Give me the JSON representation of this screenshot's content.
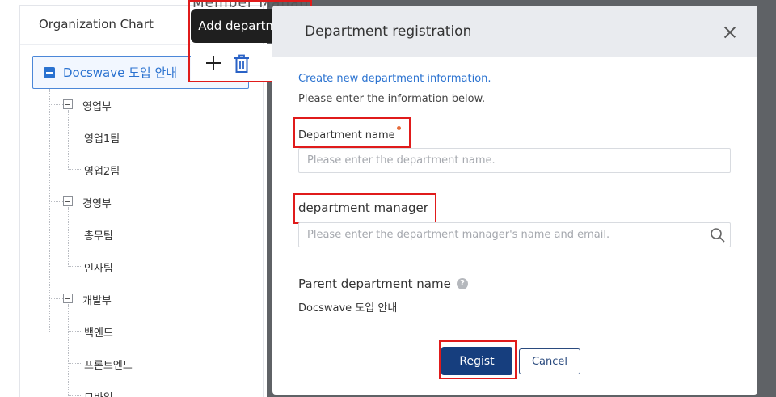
{
  "background": {
    "partial_title": "Member Manag"
  },
  "org_panel": {
    "title": "Organization Chart",
    "root": "Docswave 도입 안내",
    "tree": [
      {
        "label": "영업부",
        "kind": "dept"
      },
      {
        "label": "영업1팀",
        "kind": "team"
      },
      {
        "label": "영업2팀",
        "kind": "team"
      },
      {
        "label": "경영부",
        "kind": "dept"
      },
      {
        "label": "총무팀",
        "kind": "team"
      },
      {
        "label": "인사팀",
        "kind": "team"
      },
      {
        "label": "개발부",
        "kind": "dept"
      },
      {
        "label": "백엔드",
        "kind": "team"
      },
      {
        "label": "프론트엔드",
        "kind": "team"
      },
      {
        "label": "모바일",
        "kind": "team"
      }
    ]
  },
  "toolbar": {
    "tooltip": "Add department",
    "add_icon": "plus-icon",
    "delete_icon": "trash-icon"
  },
  "modal": {
    "title": "Department registration",
    "intro_line1": "Create new department information.",
    "intro_line2": "Please enter the information below.",
    "dept_name_label": "Department name",
    "dept_name_placeholder": "Please enter the department name.",
    "manager_label": "department manager",
    "manager_placeholder": "Please enter the department manager's name and email.",
    "parent_label": "Parent department name",
    "parent_value": "Docswave 도입 안내",
    "regist_label": "Regist",
    "cancel_label": "Cancel"
  },
  "colors": {
    "accent": "#2a72d0",
    "primary_button": "#163e7e",
    "highlight": "#e01b1b",
    "required_dot": "#e56b3a"
  }
}
